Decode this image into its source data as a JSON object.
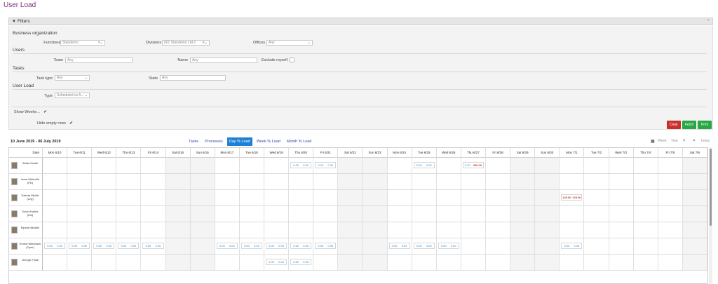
{
  "page": {
    "title": "User Load"
  },
  "filters": {
    "header": "Filters",
    "business_org": {
      "title": "Business organization",
      "functional_groups_label": "Functional groups",
      "functional_groups_value": "Standemo",
      "divisions_label": "Divisions",
      "divisions_value": "001 Standemo Ltd 2",
      "offices_label": "Offices",
      "offices_value": "Any"
    },
    "users": {
      "title": "Users",
      "team_label": "Team",
      "team_placeholder": "Any",
      "name_label": "Name",
      "name_placeholder": "Any",
      "exclude_myself_label": "Exclude myself"
    },
    "tasks": {
      "title": "Tasks",
      "task_type_label": "Task type",
      "task_type_value": "Any",
      "state_label": "State",
      "state_placeholder": "Any"
    },
    "user_load": {
      "title": "User Load",
      "type_label": "Type",
      "type_value": "Scheduled vs A..."
    },
    "show_weekends_label": "Show Weeke...",
    "show_weekends_check": "✔",
    "hide_empty_rows_label": "Hide empty rows",
    "hide_empty_rows_check": "✔",
    "buttons": {
      "clear": "Clear",
      "fetch": "Fetch",
      "print": "Print"
    }
  },
  "schedule": {
    "range": "10 June 2019 - 06 July 2019",
    "tabs": [
      "Tasks",
      "Processes",
      "Day % Load",
      "Week % Load",
      "Month % Load"
    ],
    "active_tab": "Day % Load",
    "nav": {
      "week": "Week",
      "year": "Year",
      "prev": "<",
      "next": ">",
      "today": "today"
    },
    "date_header": "Date",
    "days": [
      "Mon 6/10",
      "Tue 6/11",
      "Wed 6/12",
      "Thu 6/13",
      "Fri 6/14",
      "Sat 6/15",
      "Sun 6/16",
      "Mon 6/17",
      "Tue 6/18",
      "Wed 6/19",
      "Thu 6/20",
      "Fri 6/21",
      "Sat 6/22",
      "Sun 6/23",
      "Mon 6/24",
      "Tue 6/25",
      "Wed 6/26",
      "Thu 6/27",
      "Fri 6/28",
      "Sat 6/29",
      "Sun 6/30",
      "Mon 7/1",
      "Tue 7/2",
      "Wed 7/3",
      "Thu 7/4",
      "Fri 7/5",
      "Sat 7/6"
    ],
    "weekend_indices": [
      5,
      6,
      12,
      13,
      19,
      20,
      26
    ],
    "users": [
      {
        "name": "Aidan Heath",
        "cells": [
          {
            "i": 10,
            "a": "0.00",
            "b": "0.00"
          },
          {
            "i": 11,
            "a": "0.00",
            "b": "0.00"
          },
          {
            "i": 15,
            "a": "0.00",
            "b": "0.00"
          },
          {
            "i": 17,
            "a": "0.00",
            "b": "250.00",
            "red": true
          }
        ]
      },
      {
        "name": "Anne Mainville (Fin)",
        "cells": []
      },
      {
        "name": "Dakota Mickiri (Leg)",
        "cells": [
          {
            "i": 21,
            "a": "125.00",
            "b": "125.00",
            "redBoth": true
          }
        ]
      },
      {
        "name": "David Hobbs (Ext)",
        "cells": []
      },
      {
        "name": "Elpida Nikolaki",
        "cells": []
      },
      {
        "name": "Ernest Weinbach (Oper)",
        "cells": [
          {
            "i": 0,
            "a": "0.00",
            "b": "0.00"
          },
          {
            "i": 1,
            "a": "0.00",
            "b": "0.00"
          },
          {
            "i": 2,
            "a": "0.00",
            "b": "0.00"
          },
          {
            "i": 3,
            "a": "0.00",
            "b": "0.00"
          },
          {
            "i": 4,
            "a": "0.00",
            "b": "0.00"
          },
          {
            "i": 7,
            "a": "0.00",
            "b": "0.00"
          },
          {
            "i": 8,
            "a": "0.00",
            "b": "0.00"
          },
          {
            "i": 9,
            "a": "0.00",
            "b": "0.00"
          },
          {
            "i": 10,
            "a": "0.00",
            "b": "0.00"
          },
          {
            "i": 11,
            "a": "0.00",
            "b": "0.00"
          },
          {
            "i": 14,
            "a": "0.00",
            "b": "0.00"
          },
          {
            "i": 15,
            "a": "0.00",
            "b": "0.00"
          },
          {
            "i": 16,
            "a": "0.00",
            "b": "0.00"
          },
          {
            "i": 21,
            "a": "0.00",
            "b": "0.00"
          }
        ]
      },
      {
        "name": "George Fylsk",
        "cells": [
          {
            "i": 9,
            "a": "0.00",
            "b": "0.00"
          },
          {
            "i": 10,
            "a": "0.00",
            "b": "0.00"
          }
        ]
      }
    ]
  }
}
